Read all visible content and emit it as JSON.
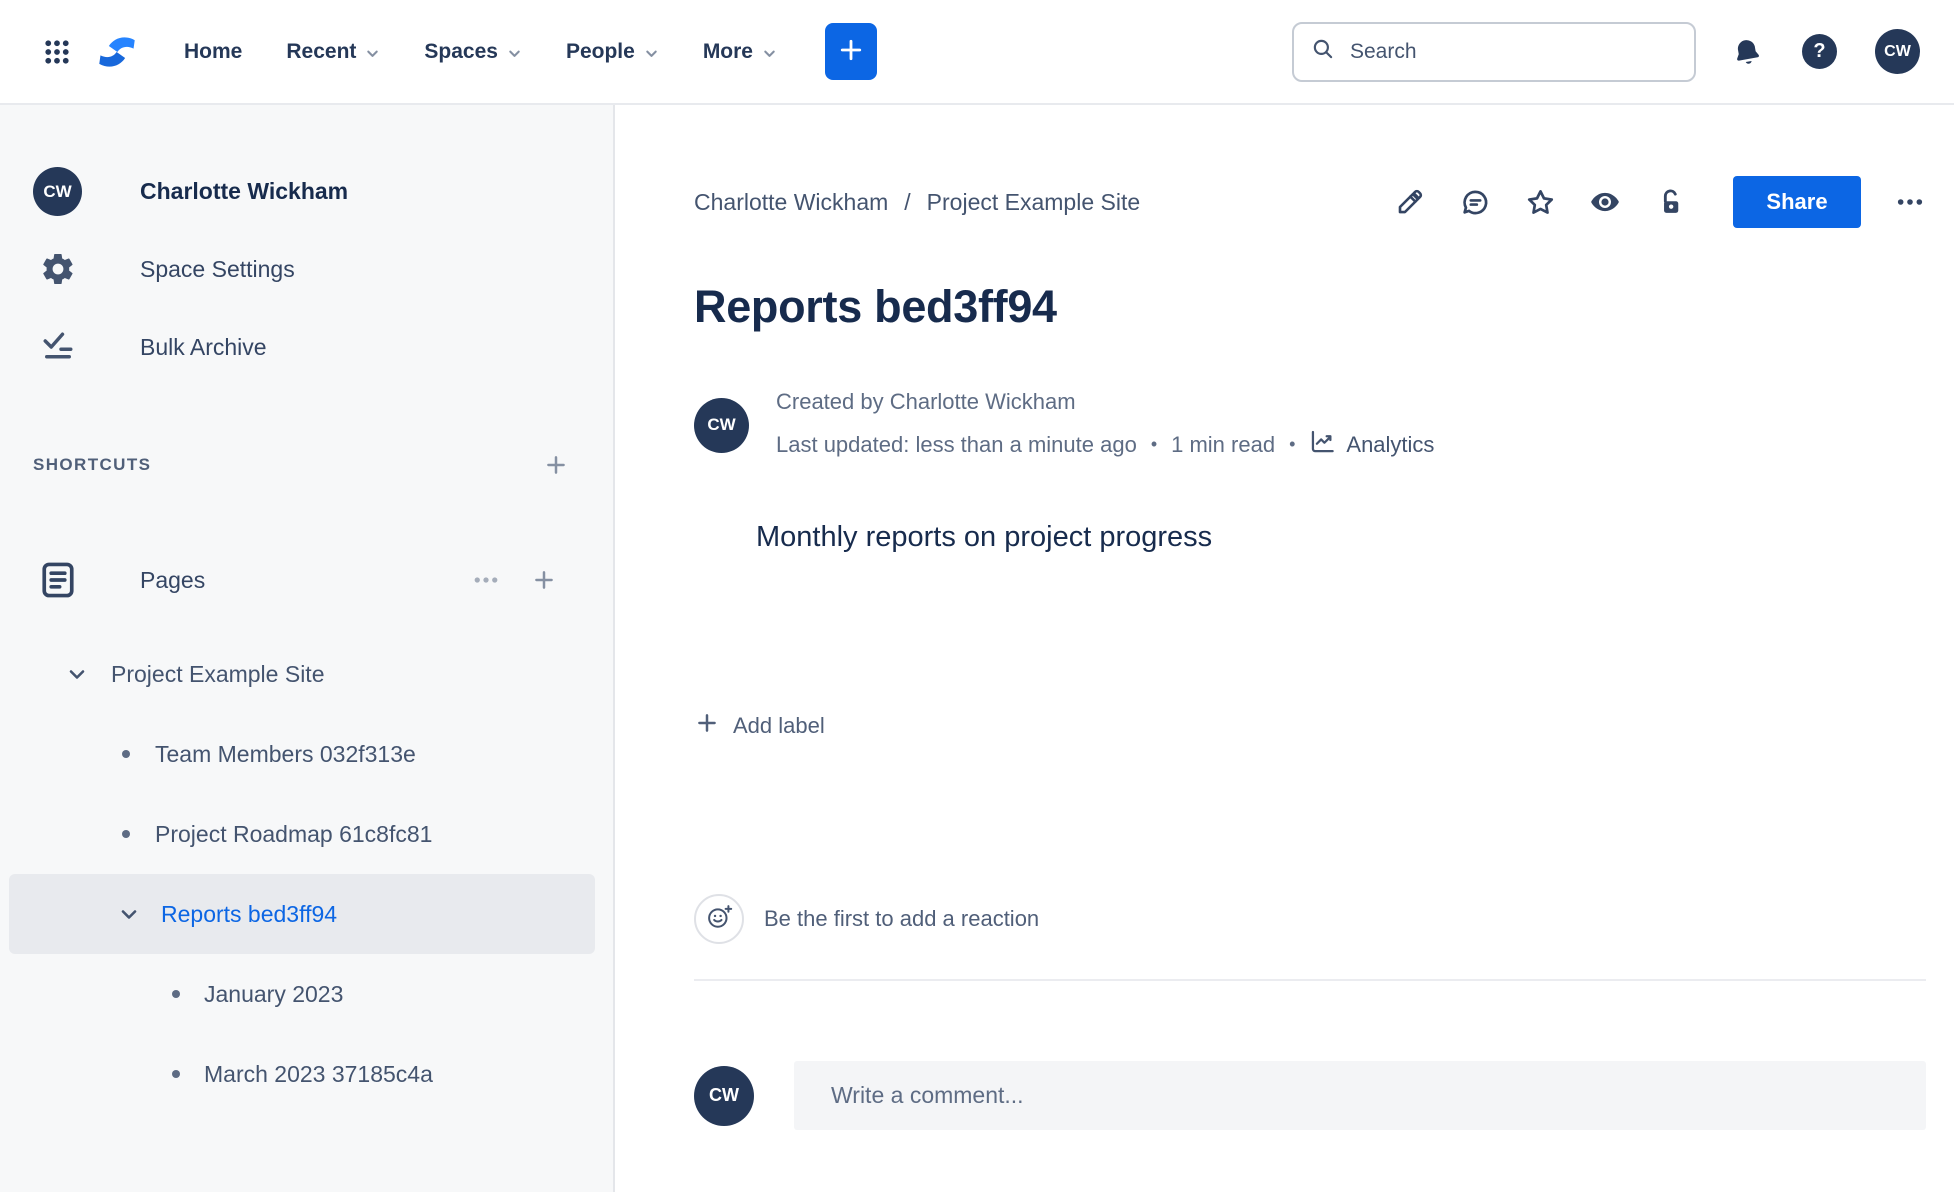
{
  "nav": {
    "links": [
      {
        "label": "Home",
        "dropdown": false
      },
      {
        "label": "Recent",
        "dropdown": true
      },
      {
        "label": "Spaces",
        "dropdown": true
      },
      {
        "label": "People",
        "dropdown": true
      },
      {
        "label": "More",
        "dropdown": true
      }
    ],
    "search": {
      "placeholder": "Search"
    },
    "help_glyph": "?",
    "avatar_initials": "CW"
  },
  "sidebar": {
    "space_avatar_initials": "CW",
    "space_name": "Charlotte Wickham",
    "menu": [
      {
        "label": "Space Settings"
      },
      {
        "label": "Bulk Archive"
      }
    ],
    "shortcuts_heading": "SHORTCUTS",
    "pages_heading": "Pages",
    "tree": [
      {
        "label": "Project Example Site",
        "depth": 0,
        "marker": "chevron-down",
        "selected": false
      },
      {
        "label": "Team Members 032f313e",
        "depth": 1,
        "marker": "bullet",
        "selected": false
      },
      {
        "label": "Project Roadmap 61c8fc81",
        "depth": 1,
        "marker": "bullet",
        "selected": false
      },
      {
        "label": "Reports bed3ff94",
        "depth": 1,
        "marker": "chevron-down",
        "selected": true
      },
      {
        "label": "January 2023",
        "depth": 2,
        "marker": "bullet",
        "selected": false
      },
      {
        "label": "March 2023 37185c4a",
        "depth": 2,
        "marker": "bullet",
        "selected": false
      }
    ]
  },
  "main": {
    "breadcrumb": {
      "items": [
        "Charlotte Wickham",
        "Project Example Site"
      ],
      "separator": "/"
    },
    "actions": {
      "share_label": "Share"
    },
    "title": "Reports bed3ff94",
    "byline": {
      "avatar_initials": "CW",
      "created_line": "Created by Charlotte Wickham",
      "updated_text": "Last updated: less than a minute ago",
      "separator": "•",
      "read_time": "1 min read",
      "analytics_label": "Analytics"
    },
    "body_text": "Monthly reports on project progress",
    "labels": {
      "add_label": "Add label"
    },
    "reactions": {
      "prompt": "Be the first to add a reaction"
    },
    "comments": {
      "placeholder": "Write a comment...",
      "avatar_initials": "CW"
    }
  },
  "colors": {
    "accent_blue": "#0C66E4",
    "navy_text": "#172B4D",
    "slate_text": "#44546F",
    "muted_text": "#626F86",
    "sidebar_bg": "#F7F8F9",
    "selected_row_bg": "#E8EAEE",
    "border": "#E4E6EA",
    "avatar_bg": "#253858",
    "comment_box_bg": "#F4F5F7"
  }
}
